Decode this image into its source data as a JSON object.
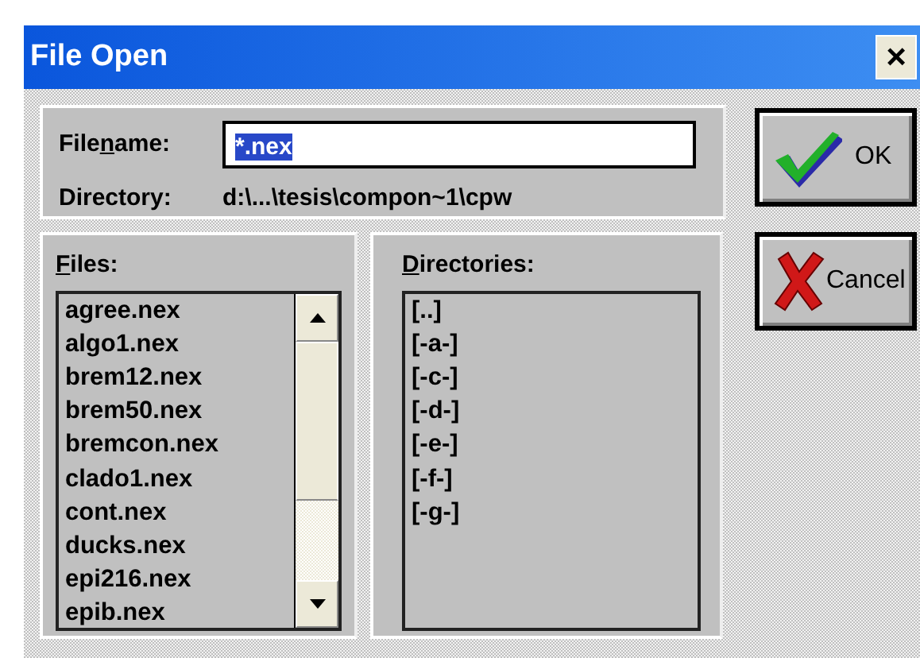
{
  "window": {
    "title": "File Open",
    "close": "×"
  },
  "filename": {
    "label": {
      "before": "File",
      "mnemonic": "n",
      "after": "ame:"
    },
    "value": "*.nex",
    "selected": true
  },
  "directory": {
    "label": "Directory:",
    "value": "d:\\...\\tesis\\compon~1\\cpw"
  },
  "files": {
    "label": {
      "mnemonic": "F",
      "after": "iles:"
    },
    "items": [
      "agree.nex",
      "algo1.nex",
      "brem12.nex",
      "brem50.nex",
      "bremcon.nex",
      "clado1.nex",
      "cont.nex",
      "ducks.nex",
      "epi216.nex",
      "epib.nex"
    ]
  },
  "directories": {
    "label": {
      "mnemonic": "D",
      "after": "irectories:"
    },
    "items": [
      "[..]",
      "[-a-]",
      "[-c-]",
      "[-d-]",
      "[-e-]",
      "[-f-]",
      "[-g-]"
    ]
  },
  "buttons": [
    {
      "kind": "ok",
      "label": "OK"
    },
    {
      "kind": "cancel",
      "label": "Cancel"
    }
  ]
}
